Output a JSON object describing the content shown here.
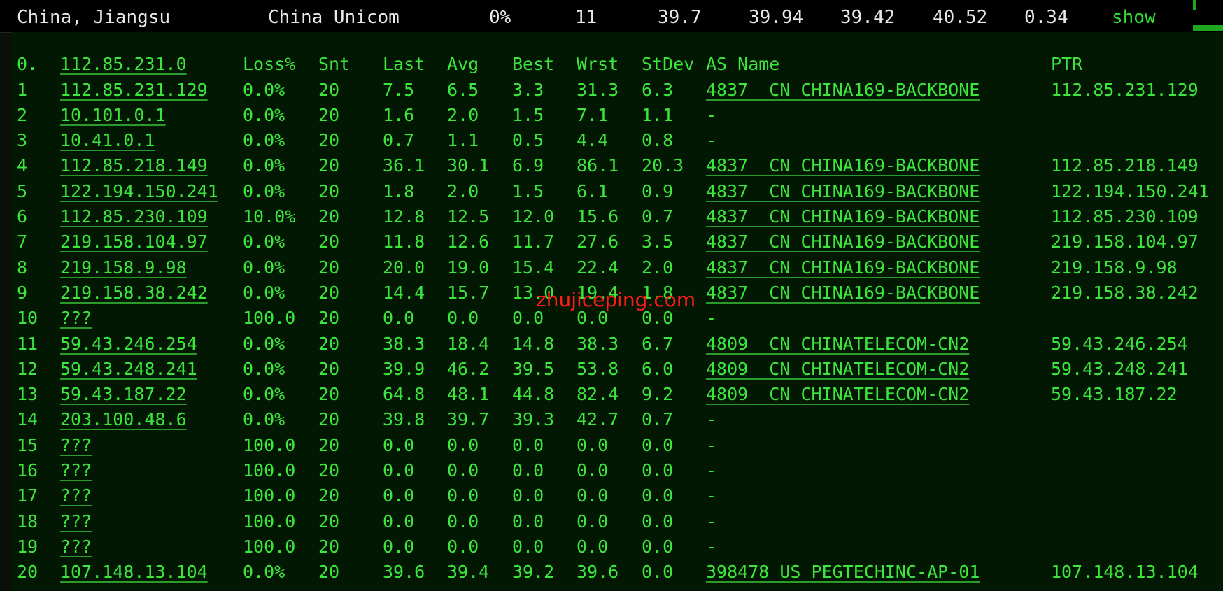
{
  "summary": {
    "location": "China, Jiangsu",
    "isp": "China Unicom",
    "loss": "0%",
    "hops": "11",
    "last": "39.7",
    "avg": "39.94",
    "best": "39.42",
    "worst": "40.52",
    "stdev": "0.34",
    "show_label": "show"
  },
  "table": {
    "header": {
      "hop": "0.",
      "host": "112.85.231.0",
      "loss": "Loss%",
      "snt": "Snt",
      "last": "Last",
      "avg": "Avg",
      "best": "Best",
      "wrst": "Wrst",
      "stdev": "StDev",
      "as_name": "AS Name",
      "ptr": "PTR"
    },
    "rows": [
      {
        "hop": "1",
        "host": "112.85.231.129",
        "loss": "0.0%",
        "snt": "20",
        "last": "7.5",
        "avg": "6.5",
        "best": "3.3",
        "wrst": "31.3",
        "stdev": "6.3",
        "as_name": "4837  CN CHINA169-BACKBONE",
        "ptr": "112.85.231.129"
      },
      {
        "hop": "2",
        "host": "10.101.0.1",
        "loss": "0.0%",
        "snt": "20",
        "last": "1.6",
        "avg": "2.0",
        "best": "1.5",
        "wrst": "7.1",
        "stdev": "1.1",
        "as_name": "-",
        "ptr": ""
      },
      {
        "hop": "3",
        "host": "10.41.0.1",
        "loss": "0.0%",
        "snt": "20",
        "last": "0.7",
        "avg": "1.1",
        "best": "0.5",
        "wrst": "4.4",
        "stdev": "0.8",
        "as_name": "-",
        "ptr": ""
      },
      {
        "hop": "4",
        "host": "112.85.218.149",
        "loss": "0.0%",
        "snt": "20",
        "last": "36.1",
        "avg": "30.1",
        "best": "6.9",
        "wrst": "86.1",
        "stdev": "20.3",
        "as_name": "4837  CN CHINA169-BACKBONE",
        "ptr": "112.85.218.149"
      },
      {
        "hop": "5",
        "host": "122.194.150.241",
        "loss": "0.0%",
        "snt": "20",
        "last": "1.8",
        "avg": "2.0",
        "best": "1.5",
        "wrst": "6.1",
        "stdev": "0.9",
        "as_name": "4837  CN CHINA169-BACKBONE",
        "ptr": "122.194.150.241"
      },
      {
        "hop": "6",
        "host": "112.85.230.109",
        "loss": "10.0%",
        "snt": "20",
        "last": "12.8",
        "avg": "12.5",
        "best": "12.0",
        "wrst": "15.6",
        "stdev": "0.7",
        "as_name": "4837  CN CHINA169-BACKBONE",
        "ptr": "112.85.230.109"
      },
      {
        "hop": "7",
        "host": "219.158.104.97",
        "loss": "0.0%",
        "snt": "20",
        "last": "11.8",
        "avg": "12.6",
        "best": "11.7",
        "wrst": "27.6",
        "stdev": "3.5",
        "as_name": "4837  CN CHINA169-BACKBONE",
        "ptr": "219.158.104.97"
      },
      {
        "hop": "8",
        "host": "219.158.9.98",
        "loss": "0.0%",
        "snt": "20",
        "last": "20.0",
        "avg": "19.0",
        "best": "15.4",
        "wrst": "22.4",
        "stdev": "2.0",
        "as_name": "4837  CN CHINA169-BACKBONE",
        "ptr": "219.158.9.98"
      },
      {
        "hop": "9",
        "host": "219.158.38.242",
        "loss": "0.0%",
        "snt": "20",
        "last": "14.4",
        "avg": "15.7",
        "best": "13.0",
        "wrst": "19.4",
        "stdev": "1.8",
        "as_name": "4837  CN CHINA169-BACKBONE",
        "ptr": "219.158.38.242"
      },
      {
        "hop": "10",
        "host": "???",
        "loss": "100.0",
        "snt": "20",
        "last": "0.0",
        "avg": "0.0",
        "best": "0.0",
        "wrst": "0.0",
        "stdev": "0.0",
        "as_name": "-",
        "ptr": ""
      },
      {
        "hop": "11",
        "host": "59.43.246.254",
        "loss": "0.0%",
        "snt": "20",
        "last": "38.3",
        "avg": "18.4",
        "best": "14.8",
        "wrst": "38.3",
        "stdev": "6.7",
        "as_name": "4809  CN CHINATELECOM-CN2",
        "ptr": "59.43.246.254"
      },
      {
        "hop": "12",
        "host": "59.43.248.241",
        "loss": "0.0%",
        "snt": "20",
        "last": "39.9",
        "avg": "46.2",
        "best": "39.5",
        "wrst": "53.8",
        "stdev": "6.0",
        "as_name": "4809  CN CHINATELECOM-CN2",
        "ptr": "59.43.248.241"
      },
      {
        "hop": "13",
        "host": "59.43.187.22",
        "loss": "0.0%",
        "snt": "20",
        "last": "64.8",
        "avg": "48.1",
        "best": "44.8",
        "wrst": "82.4",
        "stdev": "9.2",
        "as_name": "4809  CN CHINATELECOM-CN2",
        "ptr": "59.43.187.22"
      },
      {
        "hop": "14",
        "host": "203.100.48.6",
        "loss": "0.0%",
        "snt": "20",
        "last": "39.8",
        "avg": "39.7",
        "best": "39.3",
        "wrst": "42.7",
        "stdev": "0.7",
        "as_name": "-",
        "ptr": ""
      },
      {
        "hop": "15",
        "host": "???",
        "loss": "100.0",
        "snt": "20",
        "last": "0.0",
        "avg": "0.0",
        "best": "0.0",
        "wrst": "0.0",
        "stdev": "0.0",
        "as_name": "-",
        "ptr": ""
      },
      {
        "hop": "16",
        "host": "???",
        "loss": "100.0",
        "snt": "20",
        "last": "0.0",
        "avg": "0.0",
        "best": "0.0",
        "wrst": "0.0",
        "stdev": "0.0",
        "as_name": "-",
        "ptr": ""
      },
      {
        "hop": "17",
        "host": "???",
        "loss": "100.0",
        "snt": "20",
        "last": "0.0",
        "avg": "0.0",
        "best": "0.0",
        "wrst": "0.0",
        "stdev": "0.0",
        "as_name": "-",
        "ptr": ""
      },
      {
        "hop": "18",
        "host": "???",
        "loss": "100.0",
        "snt": "20",
        "last": "0.0",
        "avg": "0.0",
        "best": "0.0",
        "wrst": "0.0",
        "stdev": "0.0",
        "as_name": "-",
        "ptr": ""
      },
      {
        "hop": "19",
        "host": "???",
        "loss": "100.0",
        "snt": "20",
        "last": "0.0",
        "avg": "0.0",
        "best": "0.0",
        "wrst": "0.0",
        "stdev": "0.0",
        "as_name": "-",
        "ptr": ""
      },
      {
        "hop": "20",
        "host": "107.148.13.104",
        "loss": "0.0%",
        "snt": "20",
        "last": "39.6",
        "avg": "39.4",
        "best": "39.2",
        "wrst": "39.6",
        "stdev": "0.0",
        "as_name": "398478 US PEGTECHINC-AP-01",
        "ptr": "107.148.13.104"
      }
    ]
  },
  "watermark": "zhujiceping.com",
  "colors": {
    "text_green": "#3de63d",
    "header_white": "#e8e8e8",
    "link_green": "#2fe02f",
    "watermark_red": "#ff1a1a",
    "background": "#031803"
  }
}
